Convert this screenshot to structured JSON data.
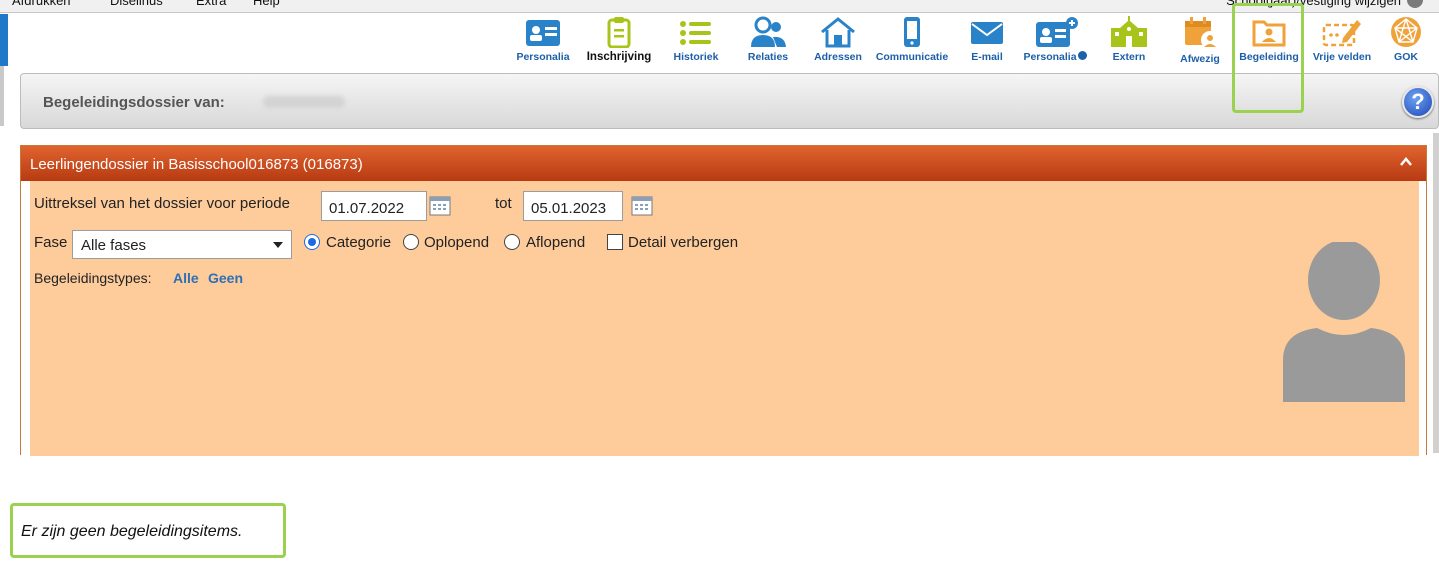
{
  "menubar": {
    "items": [
      "Afdrukken",
      "Diselinus",
      "Extra",
      "Help"
    ],
    "right_text": "School(jaar)/vestiging wijzigen"
  },
  "toolbar": {
    "items": [
      {
        "label": "Personalia",
        "icon": "id-card-icon",
        "color": "#2a83c9"
      },
      {
        "label": "Inschrijving",
        "icon": "clipboard-icon",
        "color": "#a8c41a"
      },
      {
        "label": "Historiek",
        "icon": "list-icon",
        "color": "#a8c41a"
      },
      {
        "label": "Relaties",
        "icon": "people-icon",
        "color": "#2a83c9"
      },
      {
        "label": "Adressen",
        "icon": "house-icon",
        "color": "#2a83c9"
      },
      {
        "label": "Communicatie",
        "icon": "phone-icon",
        "color": "#2a83c9"
      },
      {
        "label": "E-mail",
        "icon": "envelope-icon",
        "color": "#2a83c9"
      },
      {
        "label": "Personalia",
        "icon": "id-card-plus-icon",
        "color": "#2a83c9"
      },
      {
        "label": "Extern",
        "icon": "school-icon",
        "color": "#a8c41a"
      },
      {
        "label": "Afwezig",
        "icon": "calendar-user-icon",
        "color": "#f0a23a"
      },
      {
        "label": "Begeleiding",
        "icon": "folder-user-icon",
        "color": "#f0a23a"
      },
      {
        "label": "Vrije velden",
        "icon": "edit-icon",
        "color": "#f0a23a"
      },
      {
        "label": "GOK",
        "icon": "globe-network-icon",
        "color": "#f0a23a"
      }
    ]
  },
  "header": {
    "title": "Begeleidingsdossier van:",
    "help": "?"
  },
  "panel": {
    "title": "Leerlingendossier in Basisschool016873 (016873)",
    "period_label": "Uittreksel van het dossier voor periode",
    "date_from": "01.07.2022",
    "to_label": "tot",
    "date_to": "05.01.2023",
    "phase_label": "Fase",
    "phase_value": "Alle fases",
    "radio_categorie": "Categorie",
    "radio_oplopend": "Oplopend",
    "radio_aflopend": "Aflopend",
    "check_detail": "Detail verbergen",
    "types_label": "Begeleidingstypes:",
    "types_all": "Alle",
    "types_none": "Geen",
    "colors": {
      "header": "#c8461b",
      "body": "#fecb9b"
    }
  },
  "empty_message": "Er zijn geen begeleidingsitems.",
  "highlight_color": "#9ad14f"
}
